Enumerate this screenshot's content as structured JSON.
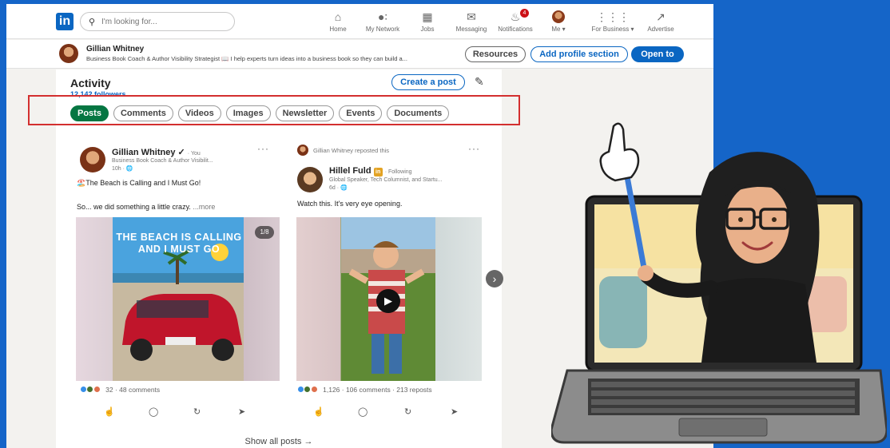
{
  "nav": {
    "logo": "in",
    "search_placeholder": "I'm looking for...",
    "items": [
      {
        "label": "Home",
        "icon": "home-icon",
        "glyph": "⌂"
      },
      {
        "label": "My Network",
        "icon": "network-icon",
        "glyph": "👥"
      },
      {
        "label": "Jobs",
        "icon": "briefcase-icon",
        "glyph": "💼"
      },
      {
        "label": "Messaging",
        "icon": "message-icon",
        "glyph": "💬"
      },
      {
        "label": "Notifications",
        "icon": "bell-icon",
        "glyph": "🔔",
        "badge": "4"
      },
      {
        "label": "Me ▾",
        "icon": "avatar"
      },
      {
        "label": "For Business ▾",
        "icon": "grid-icon",
        "glyph": "⋮⋮⋮"
      },
      {
        "label": "Advertise",
        "icon": "advertise-icon",
        "glyph": "↗"
      }
    ]
  },
  "profile_bar": {
    "name": "Gillian Whitney",
    "headline": "Business Book Coach & Author Visibility Strategist 📖 I help experts turn ideas into a business book so they can build a...",
    "resources_label": "Resources",
    "add_section_label": "Add profile section",
    "open_to_label": "Open to"
  },
  "activity": {
    "title": "Activity",
    "followers": "12,142 followers",
    "create_post_label": "Create a post",
    "filters": [
      "Posts",
      "Comments",
      "Videos",
      "Images",
      "Newsletter",
      "Events",
      "Documents"
    ],
    "active_filter": "Posts",
    "show_all": "Show all posts →"
  },
  "posts": [
    {
      "author": "Gillian Whitney ✓",
      "you": "· You",
      "subtitle": "Business Book Coach & Author Visibilit...",
      "time": "10h · 🌐",
      "line1": "🏖️The Beach is Calling and I Must Go!",
      "line2": "So... we did something a little crazy.",
      "more": "...more",
      "image_caption_1": "THE BEACH IS CALLING",
      "image_caption_2": "AND I MUST GO",
      "counter": "1/8",
      "reactions": "32 · 48 comments"
    },
    {
      "reposted_by": "Gillian Whitney reposted this",
      "author": "Hillel Fuld",
      "in_badge": "in",
      "following": "· Following",
      "subtitle": "Global Speaker, Tech Columnist, and Startu...",
      "time": "6d · 🌐",
      "line1": "Watch this. It's very eye opening.",
      "reactions": "1,126 · 106 comments · 213 reposts"
    }
  ],
  "colors": {
    "background": "#1565c8",
    "linkedin_blue": "#0a66c2",
    "posts_green": "#057642",
    "highlight_red": "#d32f2f"
  }
}
